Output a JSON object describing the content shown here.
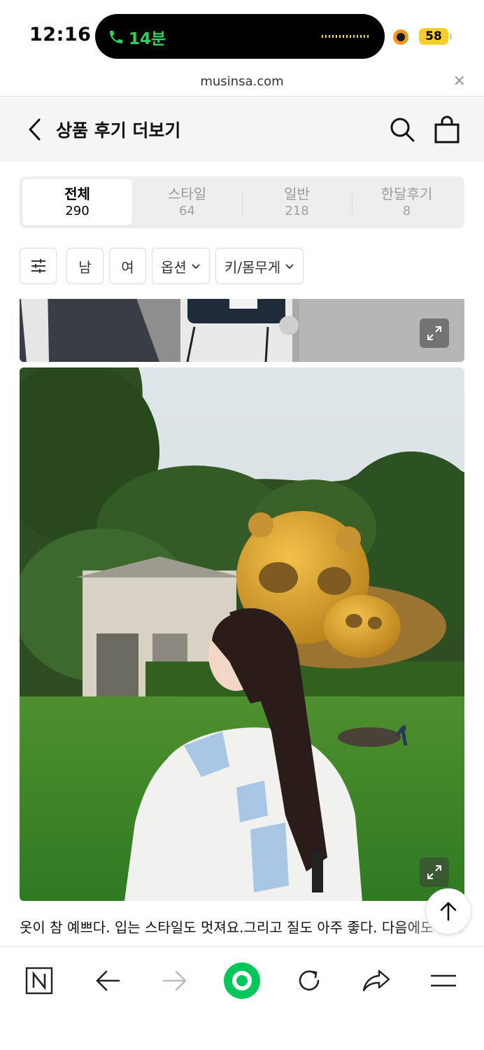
{
  "status_bar": {
    "time": "12:16",
    "call_duration": "14분",
    "battery": "58"
  },
  "browser": {
    "url": "musinsa.com",
    "close_icon": "close-icon"
  },
  "header": {
    "title": "상품 후기 더보기",
    "back_icon": "chevron-left-icon",
    "search_icon": "search-icon",
    "bag_icon": "shopping-bag-icon"
  },
  "tabs": [
    {
      "label": "전체",
      "count": "290",
      "active": true
    },
    {
      "label": "스타일",
      "count": "64",
      "active": false
    },
    {
      "label": "일반",
      "count": "218",
      "active": false
    },
    {
      "label": "한달후기",
      "count": "8",
      "active": false
    }
  ],
  "filters": {
    "settings_icon": "filter-sliders-icon",
    "male": "남",
    "female": "여",
    "option": "옵션",
    "height_weight": "키/몸무게"
  },
  "review": {
    "text": "옷이 참 예쁘다. 입는 스타일도 멋져요.그리고 질도 아주 좋다. 다음에도 구매할게요"
  },
  "bottom_bar": {
    "icons": [
      "naver-n-icon",
      "back-arrow-icon",
      "forward-arrow-icon",
      "home-green-circle-icon",
      "refresh-icon",
      "share-icon",
      "menu-icon"
    ]
  },
  "colors": {
    "call_green": "#31d158",
    "battery_yellow": "#f7cd2e",
    "naver_green": "#03c75a"
  }
}
